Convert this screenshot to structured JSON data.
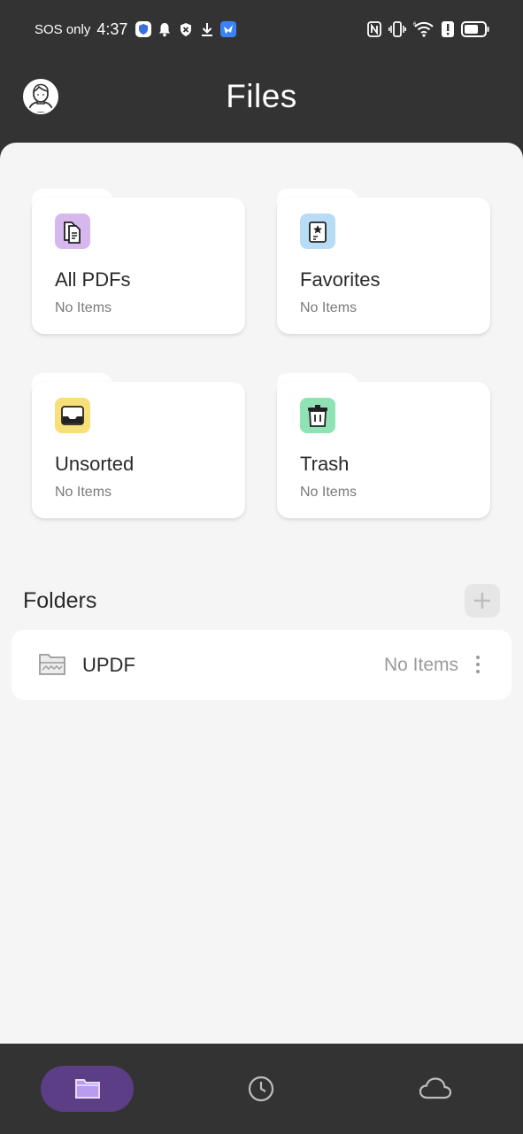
{
  "status_bar": {
    "carrier": "SOS only",
    "time": "4:37",
    "left_icons": [
      "shield-app-icon",
      "bell-icon",
      "x-shield-icon",
      "download-icon",
      "app-badge-icon"
    ],
    "right_icons": [
      "nfc-icon",
      "vibrate-icon",
      "wifi-icon",
      "alert-icon",
      "battery-icon"
    ],
    "wifi_label": "6"
  },
  "header": {
    "title": "Files",
    "avatar_icon": "avatar-icon"
  },
  "cards": [
    {
      "title": "All PDFs",
      "subtitle": "No Items",
      "icon": "documents-icon",
      "color": "#d6b8ee"
    },
    {
      "title": "Favorites",
      "subtitle": "No Items",
      "icon": "star-document-icon",
      "color": "#b9dcf6"
    },
    {
      "title": "Unsorted",
      "subtitle": "No Items",
      "icon": "inbox-tray-icon",
      "color": "#f7e07a"
    },
    {
      "title": "Trash",
      "subtitle": "No Items",
      "icon": "trash-icon",
      "color": "#8fe2b3"
    }
  ],
  "folders": {
    "heading": "Folders",
    "add_icon": "plus-icon",
    "items": [
      {
        "name": "UPDF",
        "count": "No Items",
        "icon": "folder-icon",
        "menu_icon": "more-vertical-icon"
      }
    ]
  },
  "bottom_nav": {
    "items": [
      {
        "icon": "folder-icon",
        "active": true
      },
      {
        "icon": "clock-icon",
        "active": false
      },
      {
        "icon": "cloud-icon",
        "active": false
      }
    ],
    "accent": "#5b3e86"
  }
}
